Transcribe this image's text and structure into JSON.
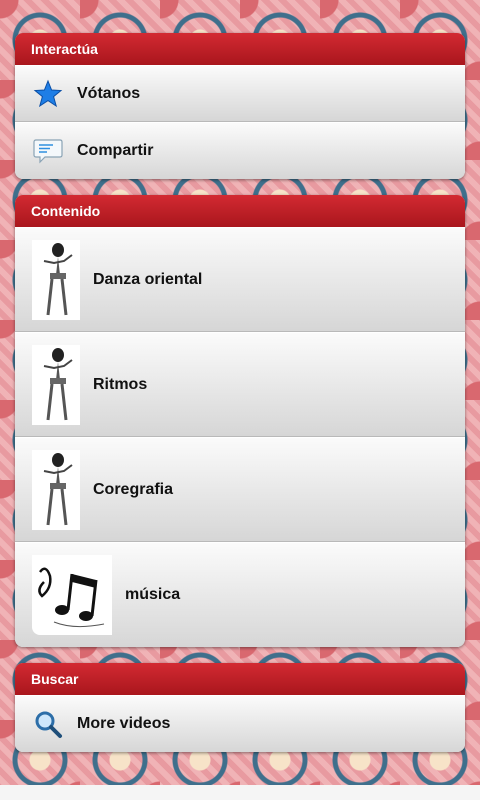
{
  "sections": {
    "interact": {
      "header": "Interactúa",
      "items": [
        {
          "label": "Vótanos",
          "icon": "star-icon"
        },
        {
          "label": "Compartir",
          "icon": "speech-bubble-icon"
        }
      ]
    },
    "content": {
      "header": "Contenido",
      "items": [
        {
          "label": "Danza oriental",
          "icon": "dancer-image"
        },
        {
          "label": "Ritmos",
          "icon": "dancer-image"
        },
        {
          "label": "Coregrafia",
          "icon": "dancer-image"
        },
        {
          "label": "música",
          "icon": "music-notes-image"
        }
      ]
    },
    "search": {
      "header": "Buscar",
      "items": [
        {
          "label": "More videos",
          "icon": "magnifier-icon"
        }
      ]
    }
  },
  "colors": {
    "header_red": "#c1212a",
    "star_blue": "#1e7ee6"
  }
}
